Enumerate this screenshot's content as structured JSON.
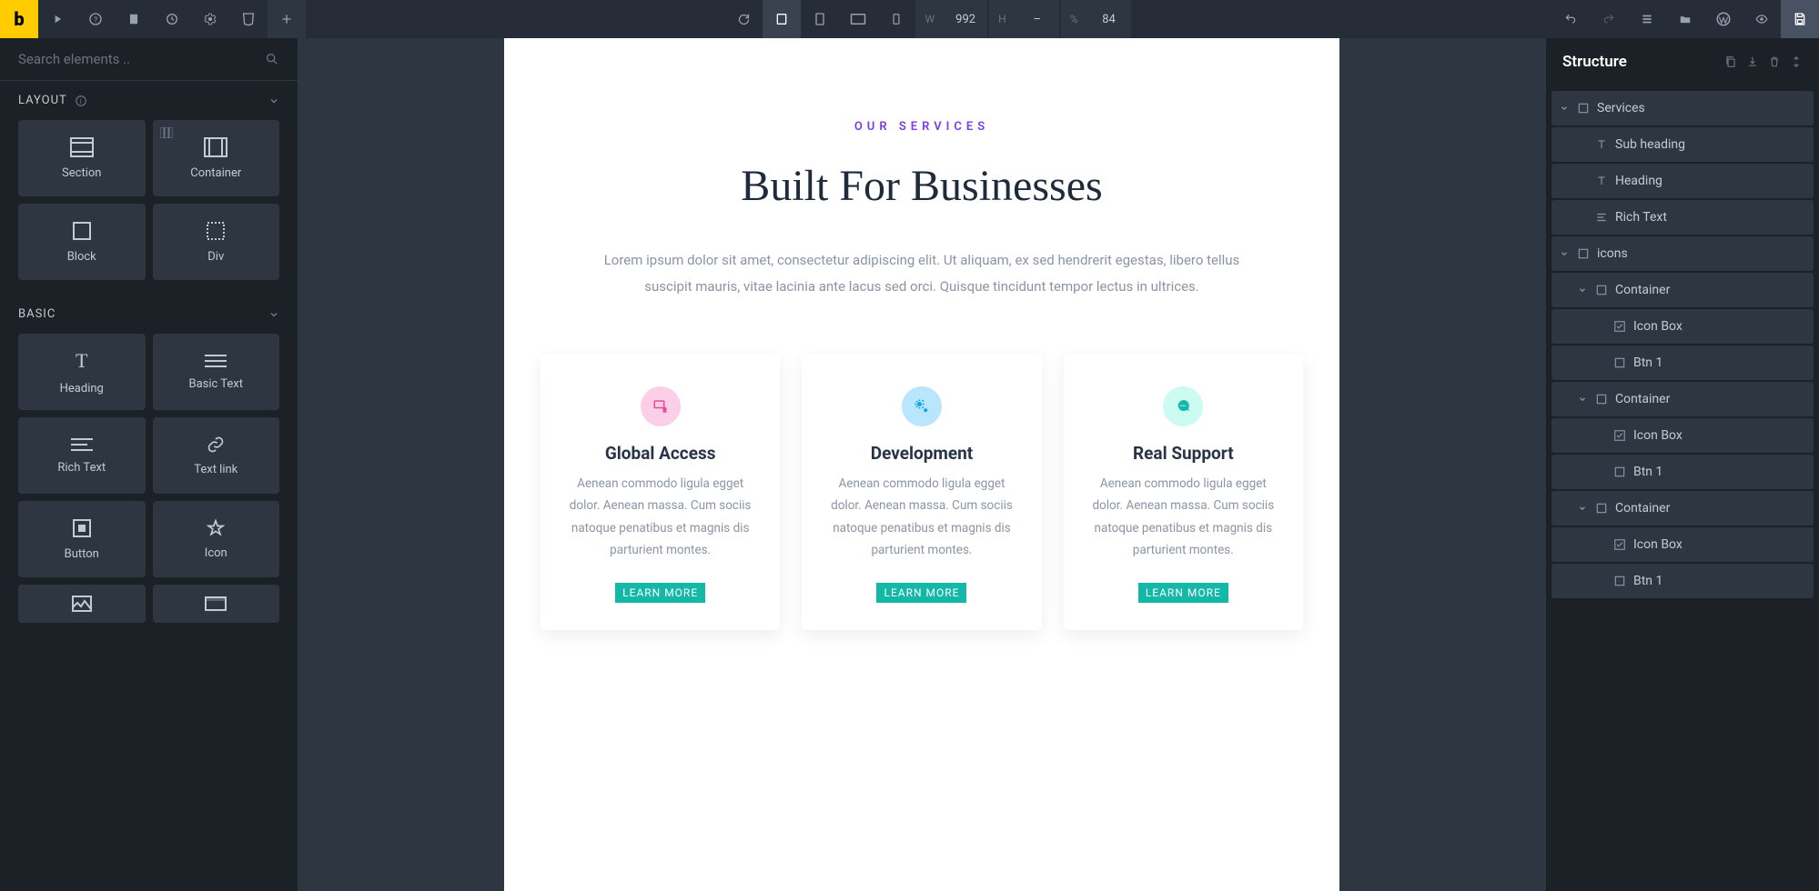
{
  "topbar": {
    "dims": {
      "w_label": "W",
      "w": "992",
      "h_label": "H",
      "h": "–",
      "pct_label": "%",
      "pct": "84"
    }
  },
  "left": {
    "search_placeholder": "Search elements ..",
    "cat_layout": "LAYOUT",
    "cat_basic": "BASIC",
    "layout": {
      "section": "Section",
      "container": "Container",
      "block": "Block",
      "div": "Div"
    },
    "basic": {
      "heading": "Heading",
      "basictext": "Basic Text",
      "richtext": "Rich Text",
      "textlink": "Text link",
      "button": "Button",
      "icon": "Icon"
    }
  },
  "canvas": {
    "eyebrow": "OUR SERVICES",
    "heading": "Built For Businesses",
    "para": "Lorem ipsum dolor sit amet, consectetur adipiscing elit. Ut aliquam, ex sed hendrerit egestas, libero tellus suscipit mauris, vitae lacinia ante lacus sed orci. Quisque tincidunt tempor lectus in ultrices.",
    "cards": [
      {
        "title": "Global Access",
        "text": "Aenean commodo ligula egget dolor. Aenean massa. Cum sociis natoque penatibus et magnis dis parturient montes.",
        "cta": "LEARN MORE"
      },
      {
        "title": "Development",
        "text": "Aenean commodo ligula egget dolor. Aenean massa. Cum sociis natoque penatibus et magnis dis parturient montes.",
        "cta": "LEARN MORE"
      },
      {
        "title": "Real Support",
        "text": "Aenean commodo ligula egget dolor. Aenean massa. Cum sociis natoque penatibus et magnis dis parturient montes.",
        "cta": "LEARN MORE"
      }
    ]
  },
  "right": {
    "title": "Structure",
    "tree": [
      {
        "d": 1,
        "tog": true,
        "icon": "rect",
        "label": "Services"
      },
      {
        "d": 2,
        "tog": false,
        "icon": "text",
        "label": "Sub heading"
      },
      {
        "d": 2,
        "tog": false,
        "icon": "text",
        "label": "Heading"
      },
      {
        "d": 2,
        "tog": false,
        "icon": "para",
        "label": "Rich Text"
      },
      {
        "d": 1,
        "tog": true,
        "icon": "rect",
        "label": "icons"
      },
      {
        "d": 2,
        "tog": true,
        "icon": "rect",
        "label": "Container"
      },
      {
        "d": 3,
        "tog": false,
        "icon": "check",
        "label": "Icon Box"
      },
      {
        "d": 3,
        "tog": false,
        "icon": "rect",
        "label": "Btn 1"
      },
      {
        "d": 2,
        "tog": true,
        "icon": "rect",
        "label": "Container"
      },
      {
        "d": 3,
        "tog": false,
        "icon": "check",
        "label": "Icon Box"
      },
      {
        "d": 3,
        "tog": false,
        "icon": "rect",
        "label": "Btn 1"
      },
      {
        "d": 2,
        "tog": true,
        "icon": "rect",
        "label": "Container"
      },
      {
        "d": 3,
        "tog": false,
        "icon": "check",
        "label": "Icon Box"
      },
      {
        "d": 3,
        "tog": false,
        "icon": "rect",
        "label": "Btn 1"
      }
    ]
  }
}
